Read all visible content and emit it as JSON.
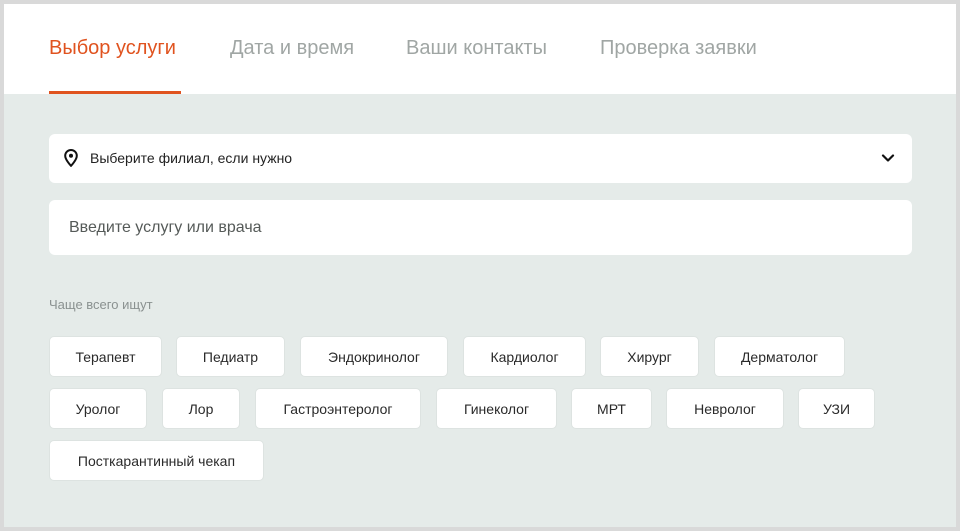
{
  "tabs": [
    {
      "label": "Выбор услуги",
      "active": true
    },
    {
      "label": "Дата и время",
      "active": false
    },
    {
      "label": "Ваши контакты",
      "active": false
    },
    {
      "label": "Проверка заявки",
      "active": false
    }
  ],
  "branch_select": {
    "label": "Выберите филиал, если нужно",
    "icon": "map-pin-icon",
    "toggle_icon": "chevron-down-icon"
  },
  "search": {
    "placeholder": "Введите услугу или врача",
    "value": ""
  },
  "popular": {
    "label": "Чаще всего ищут",
    "chips": [
      "Терапевт",
      "Педиатр",
      "Эндокринолог",
      "Кардиолог",
      "Хирург",
      "Дерматолог",
      "Уролог",
      "Лор",
      "Гастроэнтеролог",
      "Гинеколог",
      "МРТ",
      "Невролог",
      "УЗИ",
      "Посткарантинный чекап"
    ]
  },
  "colors": {
    "accent": "#e0531f",
    "background": "#e5ebe9",
    "inactive_tab": "#a0a6a4"
  }
}
